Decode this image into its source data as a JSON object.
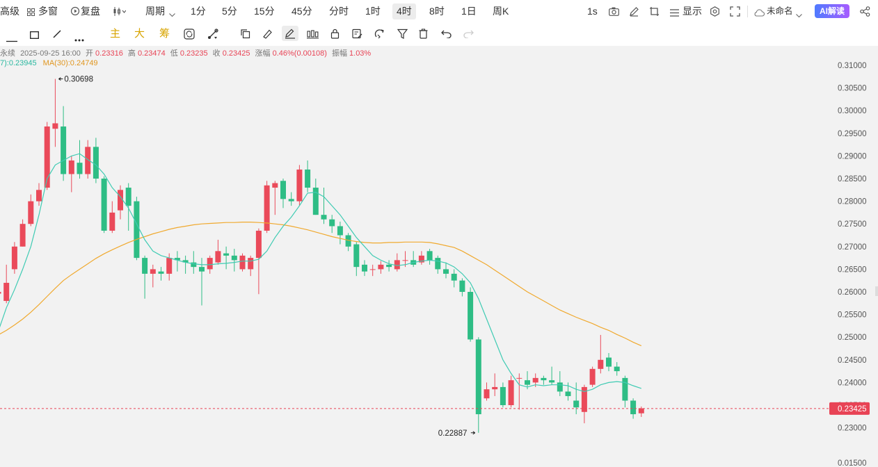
{
  "toolbar": {
    "advanced": "高级",
    "multi_window": "多窗",
    "replay": "复盘",
    "period_label": "周期",
    "intervals": [
      "1分",
      "5分",
      "15分",
      "45分",
      "分时",
      "1时",
      "4时",
      "8时",
      "1日",
      "周K"
    ],
    "active_interval": "4时",
    "refresh": "1s",
    "display_label": "显示",
    "layout_name": "未命名",
    "ai_label": "AI解读"
  },
  "drawbar": {
    "main_chars": [
      "主",
      "大",
      "筹"
    ],
    "main_color": "#d8a400"
  },
  "info": {
    "name": "永续",
    "datetime": "2025-09-25 16:00",
    "open_label": "开",
    "open": "0.23316",
    "high_label": "高",
    "high": "0.23474",
    "low_label": "低",
    "low": "0.23235",
    "close_label": "收",
    "close": "0.23425",
    "change_label": "涨幅",
    "change": "0.46%(0.00108)",
    "amp_label": "振幅",
    "amp": "1.03%",
    "ma7_label": "7):0.23945",
    "ma30_label": "MA(30):0.24749"
  },
  "colors": {
    "up": "#ea4a5a",
    "down": "#2ebd85",
    "ma7": "#3fcbb3",
    "ma30": "#f0a92e",
    "pill": "#ececec",
    "price_tag": "#e84355"
  },
  "chart_data": {
    "type": "candlestick",
    "y_ticks": [
      "0.31000",
      "0.30500",
      "0.30000",
      "0.29500",
      "0.29000",
      "0.28500",
      "0.28000",
      "0.27500",
      "0.27000",
      "0.26500",
      "0.26000",
      "0.25500",
      "0.25000",
      "0.24500",
      "0.24000",
      "0.23500",
      "0.23000",
      "0.01500"
    ],
    "last_price": "0.23425",
    "high_annotation": "0.30698",
    "low_annotation": "0.22887",
    "candles": [
      [
        0.2596,
        0.26,
        0.2608,
        0.2592
      ],
      [
        0.258,
        0.262,
        0.266,
        0.2575
      ],
      [
        0.265,
        0.27,
        0.271,
        0.264
      ],
      [
        0.27,
        0.275,
        0.276,
        0.27
      ],
      [
        0.275,
        0.28,
        0.2815,
        0.2745
      ],
      [
        0.28,
        0.2825,
        0.284,
        0.279
      ],
      [
        0.283,
        0.2965,
        0.2975,
        0.2825
      ],
      [
        0.296,
        0.2972,
        0.307,
        0.292
      ],
      [
        0.2965,
        0.286,
        0.301,
        0.2845
      ],
      [
        0.286,
        0.289,
        0.29,
        0.282
      ],
      [
        0.2885,
        0.286,
        0.2935,
        0.285
      ],
      [
        0.286,
        0.292,
        0.2935,
        0.285
      ],
      [
        0.292,
        0.285,
        0.294,
        0.284
      ],
      [
        0.285,
        0.2735,
        0.2855,
        0.273
      ],
      [
        0.2735,
        0.2775,
        0.28,
        0.273
      ],
      [
        0.278,
        0.2825,
        0.2835,
        0.276
      ],
      [
        0.283,
        0.279,
        0.284,
        0.2735
      ],
      [
        0.28,
        0.2675,
        0.281,
        0.267
      ],
      [
        0.2675,
        0.264,
        0.268,
        0.2585
      ],
      [
        0.264,
        0.265,
        0.266,
        0.261
      ],
      [
        0.2645,
        0.264,
        0.2655,
        0.2625
      ],
      [
        0.264,
        0.2675,
        0.2685,
        0.2625
      ],
      [
        0.2675,
        0.267,
        0.269,
        0.2645
      ],
      [
        0.267,
        0.2665,
        0.268,
        0.264
      ],
      [
        0.2665,
        0.2655,
        0.269,
        0.264
      ],
      [
        0.2655,
        0.2645,
        0.2675,
        0.257
      ],
      [
        0.265,
        0.2675,
        0.268,
        0.264
      ],
      [
        0.2665,
        0.269,
        0.2715,
        0.266
      ],
      [
        0.2685,
        0.268,
        0.27,
        0.265
      ],
      [
        0.268,
        0.267,
        0.2695,
        0.2645
      ],
      [
        0.265,
        0.268,
        0.2685,
        0.2645
      ],
      [
        0.265,
        0.2675,
        0.268,
        0.2635
      ],
      [
        0.2675,
        0.2735,
        0.274,
        0.2595
      ],
      [
        0.2735,
        0.2835,
        0.2845,
        0.273
      ],
      [
        0.283,
        0.284,
        0.2845,
        0.277
      ],
      [
        0.2845,
        0.2805,
        0.285,
        0.2785
      ],
      [
        0.2805,
        0.28,
        0.282,
        0.279
      ],
      [
        0.28,
        0.287,
        0.288,
        0.279
      ],
      [
        0.287,
        0.283,
        0.289,
        0.282
      ],
      [
        0.283,
        0.277,
        0.285,
        0.277
      ],
      [
        0.277,
        0.276,
        0.283,
        0.275
      ],
      [
        0.276,
        0.2745,
        0.277,
        0.273
      ],
      [
        0.2745,
        0.2725,
        0.2755,
        0.2705
      ],
      [
        0.2725,
        0.27,
        0.273,
        0.269
      ],
      [
        0.2705,
        0.2655,
        0.271,
        0.2635
      ],
      [
        0.266,
        0.2645,
        0.267,
        0.2635
      ],
      [
        0.265,
        0.265,
        0.266,
        0.2635
      ],
      [
        0.265,
        0.266,
        0.2668,
        0.264
      ],
      [
        0.266,
        0.2655,
        0.267,
        0.2645
      ],
      [
        0.265,
        0.267,
        0.2685,
        0.2645
      ],
      [
        0.267,
        0.267,
        0.269,
        0.2655
      ],
      [
        0.267,
        0.266,
        0.269,
        0.2655
      ],
      [
        0.2665,
        0.268,
        0.269,
        0.266
      ],
      [
        0.269,
        0.267,
        0.2695,
        0.266
      ],
      [
        0.2675,
        0.265,
        0.268,
        0.264
      ],
      [
        0.265,
        0.264,
        0.2665,
        0.263
      ],
      [
        0.264,
        0.2625,
        0.265,
        0.261
      ],
      [
        0.2625,
        0.26,
        0.263,
        0.259
      ],
      [
        0.26,
        0.2495,
        0.261,
        0.249
      ],
      [
        0.2495,
        0.233,
        0.25,
        0.2289
      ],
      [
        0.2365,
        0.2385,
        0.24,
        0.236
      ],
      [
        0.2385,
        0.239,
        0.242,
        0.237
      ],
      [
        0.239,
        0.235,
        0.24,
        0.2345
      ],
      [
        0.235,
        0.2405,
        0.2415,
        0.2345
      ],
      [
        0.241,
        0.241,
        0.242,
        0.234
      ],
      [
        0.2405,
        0.2395,
        0.2425,
        0.2385
      ],
      [
        0.24,
        0.241,
        0.242,
        0.239
      ],
      [
        0.241,
        0.2405,
        0.2415,
        0.2395
      ],
      [
        0.2405,
        0.24,
        0.2435,
        0.2395
      ],
      [
        0.24,
        0.238,
        0.2425,
        0.237
      ],
      [
        0.238,
        0.237,
        0.24,
        0.236
      ],
      [
        0.236,
        0.2345,
        0.24,
        0.233
      ],
      [
        0.2335,
        0.239,
        0.2395,
        0.231
      ],
      [
        0.2395,
        0.243,
        0.2435,
        0.239
      ],
      [
        0.243,
        0.245,
        0.2505,
        0.242
      ],
      [
        0.2455,
        0.2435,
        0.2465,
        0.2425
      ],
      [
        0.2435,
        0.2425,
        0.2445,
        0.2415
      ],
      [
        0.241,
        0.236,
        0.2415,
        0.2345
      ],
      [
        0.236,
        0.233,
        0.2365,
        0.232
      ],
      [
        0.2332,
        0.2343,
        0.2347,
        0.2324
      ]
    ],
    "ma7": [
      0.2513,
      0.2565,
      0.2605,
      0.265,
      0.27,
      0.277,
      0.285,
      0.288,
      0.289,
      0.29,
      0.2905,
      0.2892,
      0.288,
      0.286,
      0.283,
      0.281,
      0.2785,
      0.275,
      0.2715,
      0.269,
      0.268,
      0.2675,
      0.267,
      0.2665,
      0.2662,
      0.266,
      0.266,
      0.2662,
      0.2663,
      0.2665,
      0.2668,
      0.2668,
      0.2672,
      0.269,
      0.272,
      0.2745,
      0.2765,
      0.279,
      0.2818,
      0.282,
      0.281,
      0.279,
      0.277,
      0.2745,
      0.272,
      0.27,
      0.268,
      0.267,
      0.2662,
      0.2658,
      0.266,
      0.2665,
      0.2668,
      0.267,
      0.2668,
      0.2664,
      0.2655,
      0.264,
      0.262,
      0.2585,
      0.254,
      0.2495,
      0.245,
      0.242,
      0.2395,
      0.239,
      0.2395,
      0.2393,
      0.2395,
      0.2395,
      0.2393,
      0.2385,
      0.238,
      0.2385,
      0.2395,
      0.24,
      0.2402,
      0.24,
      0.2393,
      0.2387
    ],
    "ma30": [
      0.2505,
      0.2515,
      0.2527,
      0.254,
      0.2555,
      0.2572,
      0.259,
      0.2608,
      0.2625,
      0.2638,
      0.265,
      0.2662,
      0.2674,
      0.2684,
      0.2693,
      0.2701,
      0.2709,
      0.2716,
      0.2722,
      0.2728,
      0.2733,
      0.2738,
      0.2742,
      0.2745,
      0.2748,
      0.275,
      0.2751,
      0.2752,
      0.2753,
      0.2753,
      0.2754,
      0.2754,
      0.2753,
      0.2752,
      0.275,
      0.2748,
      0.2745,
      0.2741,
      0.2737,
      0.2732,
      0.2727,
      0.2722,
      0.2718,
      0.2714,
      0.2711,
      0.2709,
      0.2708,
      0.2708,
      0.2709,
      0.2709,
      0.271,
      0.271,
      0.271,
      0.2709,
      0.2706,
      0.2702,
      0.2698,
      0.269,
      0.268,
      0.267,
      0.266,
      0.2648,
      0.2636,
      0.2624,
      0.2612,
      0.26,
      0.259,
      0.258,
      0.257,
      0.256,
      0.2552,
      0.2544,
      0.2537,
      0.253,
      0.2522,
      0.2515,
      0.2506,
      0.2498,
      0.2489,
      0.2481
    ]
  }
}
